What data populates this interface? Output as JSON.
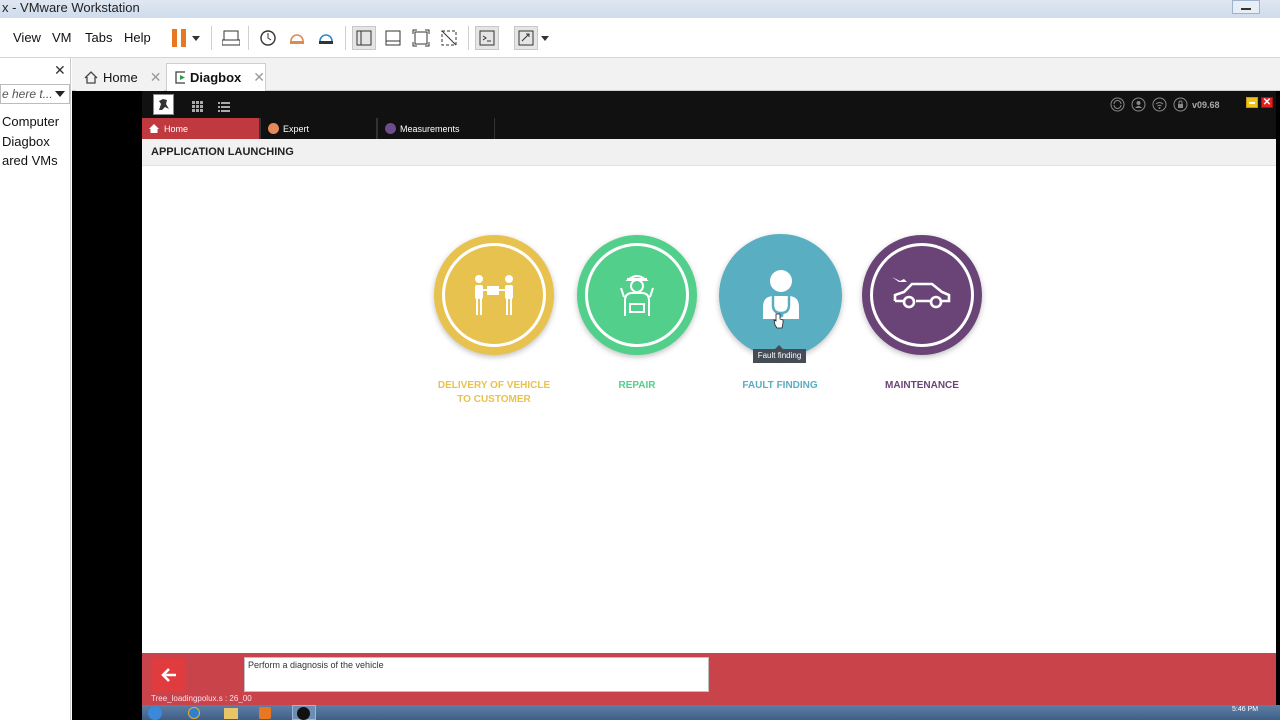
{
  "window": {
    "title": "x - VMware Workstation"
  },
  "menu": {
    "view": "View",
    "vm": "VM",
    "tabs": "Tabs",
    "help": "Help"
  },
  "sidebar": {
    "search_placeholder": "e here t...",
    "items": [
      {
        "label": "Computer"
      },
      {
        "label": "Diagbox"
      },
      {
        "label": "ared VMs"
      }
    ]
  },
  "vm_tabs": [
    {
      "label": "Home"
    },
    {
      "label": "Diagbox"
    }
  ],
  "diagbox": {
    "version": "v09.68",
    "nav": [
      {
        "label": "Home"
      },
      {
        "label": "Expert"
      },
      {
        "label": "Measurements"
      }
    ],
    "header": "APPLICATION LAUNCHING",
    "apps": [
      {
        "label": "DELIVERY OF VEHICLE\nTO CUSTOMER",
        "color": "#e8c24f"
      },
      {
        "label": "REPAIR",
        "color": "#52cf8a"
      },
      {
        "label": "FAULT FINDING",
        "color": "#5aaec1"
      },
      {
        "label": "MAINTENANCE",
        "color": "#6a4477"
      }
    ],
    "tooltip": "Fault finding",
    "message": "Perform a diagnosis of the vehicle",
    "status": "Tree_loadingpolux.s : 26_00"
  },
  "taskbar": {
    "time": "5:46 PM"
  },
  "colors": {
    "accent_red": "#c9444a",
    "home_tab": "#c0393e"
  }
}
